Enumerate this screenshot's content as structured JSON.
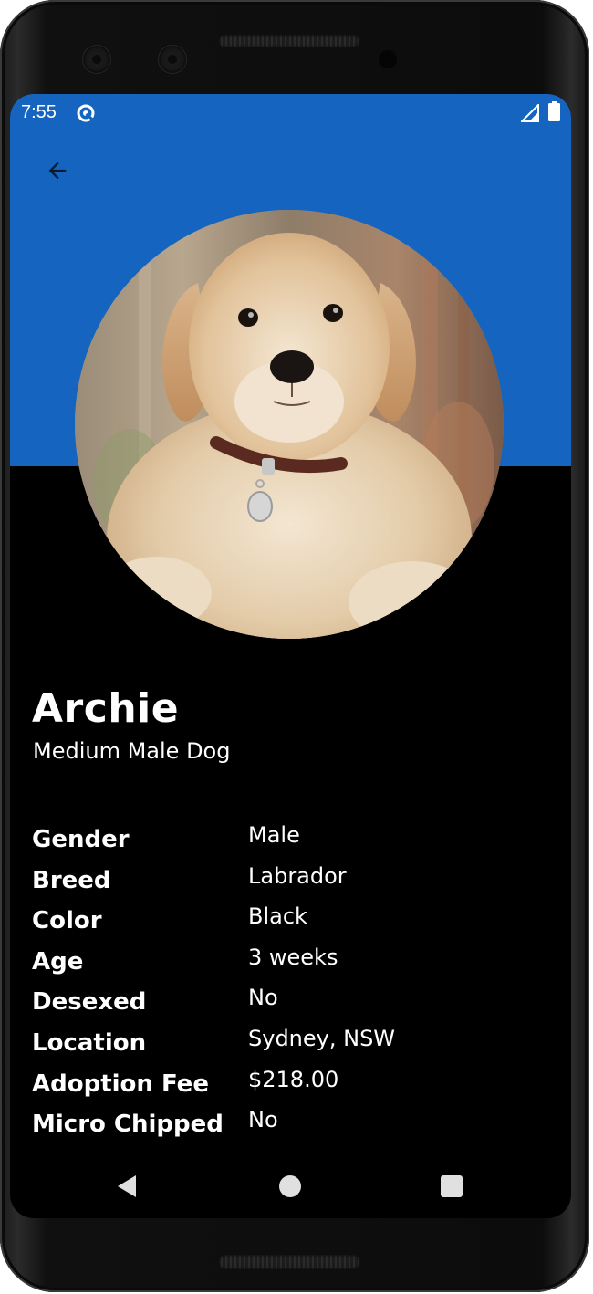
{
  "status_bar": {
    "time": "7:55",
    "data_icon": "data-saver-icon",
    "signal_icon": "cell-signal-icon",
    "battery_icon": "battery-icon"
  },
  "app_bar": {
    "back_icon": "arrow-back-icon",
    "background_color": "#1565c0"
  },
  "pet": {
    "photo": "golden retriever puppy photo",
    "name": "Archie",
    "subtitle": "Medium Male Dog"
  },
  "details": [
    {
      "label": "Gender",
      "value": "Male"
    },
    {
      "label": "Breed",
      "value": "Labrador"
    },
    {
      "label": "Color",
      "value": "Black"
    },
    {
      "label": "Age",
      "value": "3 weeks"
    },
    {
      "label": "Desexed",
      "value": "No"
    },
    {
      "label": "Location",
      "value": "Sydney, NSW"
    },
    {
      "label": "Adoption Fee",
      "value": "$218.00"
    },
    {
      "label": "Micro Chipped",
      "value": "No"
    }
  ],
  "nav_bar": {
    "back": "nav-back-icon",
    "home": "nav-home-icon",
    "recents": "nav-recents-icon"
  }
}
